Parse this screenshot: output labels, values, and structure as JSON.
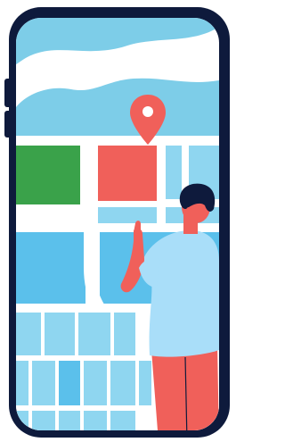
{
  "illustration": {
    "subject": "phone-map-navigation",
    "icons": [
      "location-pin-icon"
    ]
  },
  "colors": {
    "phone_frame": "#0E1A3C",
    "screen_bg": "#FFFFFF",
    "sky": "#7DCDE8",
    "map_block_blue": "#5BC0EB",
    "map_block_light": "#8FD6F0",
    "map_block_green": "#3AA24A",
    "map_block_red": "#F0605A",
    "pin": "#F0605A",
    "person_shirt": "#A9DEF9",
    "person_pants": "#F0605A",
    "person_skin": "#F0605A",
    "person_hair": "#0E1A3C"
  }
}
